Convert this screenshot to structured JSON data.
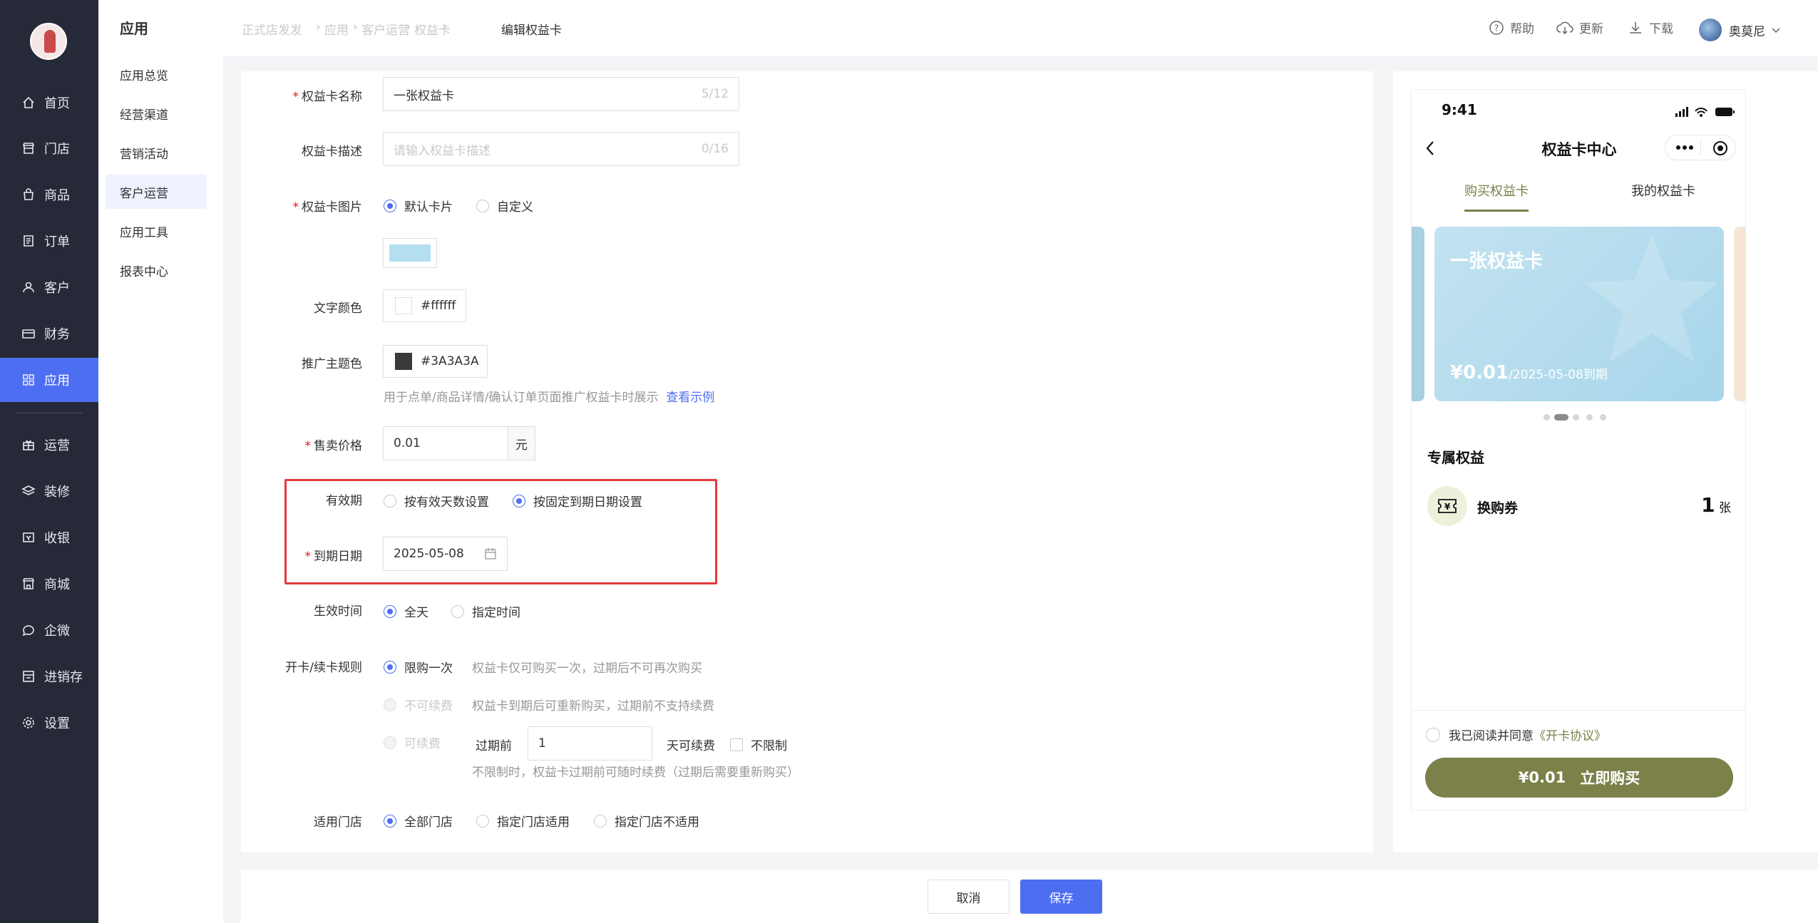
{
  "sidebar": {
    "items": [
      {
        "label": "首页",
        "icon": "home-icon"
      },
      {
        "label": "门店",
        "icon": "store-icon"
      },
      {
        "label": "商品",
        "icon": "bag-icon"
      },
      {
        "label": "订单",
        "icon": "order-icon"
      },
      {
        "label": "客户",
        "icon": "user-icon"
      },
      {
        "label": "财务",
        "icon": "card-icon"
      },
      {
        "label": "应用",
        "icon": "apps-icon",
        "active": true
      },
      {
        "label": "运营",
        "icon": "gift-icon"
      },
      {
        "label": "装修",
        "icon": "layers-icon"
      },
      {
        "label": "收银",
        "icon": "cashier-icon"
      },
      {
        "label": "商城",
        "icon": "mall-icon"
      },
      {
        "label": "企微",
        "icon": "chat-icon"
      },
      {
        "label": "进销存",
        "icon": "inventory-icon"
      },
      {
        "label": "设置",
        "icon": "settings-icon"
      }
    ]
  },
  "subnav": {
    "title": "应用",
    "items": [
      "应用总览",
      "经营渠道",
      "营销活动",
      "客户运营",
      "应用工具",
      "报表中心"
    ],
    "active_index": 3
  },
  "breadcrumb": [
    "正式店发发",
    "应用",
    "客户运营",
    "权益卡",
    "编辑权益卡"
  ],
  "topbar": {
    "help": "帮助",
    "update": "更新",
    "download": "下载",
    "user": "奥莫尼"
  },
  "form": {
    "name": {
      "label": "权益卡名称",
      "value": "一张权益卡",
      "count": "5/12"
    },
    "desc": {
      "label": "权益卡描述",
      "placeholder": "请输入权益卡描述",
      "count": "0/16"
    },
    "image": {
      "label": "权益卡图片",
      "options": [
        "默认卡片",
        "自定义"
      ],
      "selected": 0,
      "swatch_color": "#b3dff0"
    },
    "text_color": {
      "label": "文字颜色",
      "value": "#ffffff"
    },
    "theme_color": {
      "label": "推广主题色",
      "value": "#3A3A3A",
      "hint": "用于点单/商品详情/确认订单页面推广权益卡时展示",
      "hint_link": "查看示例"
    },
    "price": {
      "label": "售卖价格",
      "value": "0.01",
      "unit": "元"
    },
    "validity": {
      "label": "有效期",
      "options": [
        "按有效天数设置",
        "按固定到期日期设置"
      ],
      "selected": 1
    },
    "expire": {
      "label": "到期日期",
      "value": "2025-05-08"
    },
    "effective": {
      "label": "生效时间",
      "options": [
        "全天",
        "指定时间"
      ],
      "selected": 0
    },
    "rules": {
      "label": "开卡/续卡规则",
      "opt1": "限购一次",
      "opt1_hint": "权益卡仅可购买一次，过期后不可再次购买",
      "opt2": "不可续费",
      "opt2_hint": "权益卡到期后可重新购买，过期前不支持续费",
      "opt3": "可续费",
      "before": "过期前",
      "days_value": "1",
      "days_suffix": "天可续费",
      "unlimited": "不限制",
      "opt3_hint": "不限制时，权益卡过期前可随时续费（过期后需要重新购买）"
    },
    "stores": {
      "label": "适用门店",
      "options": [
        "全部门店",
        "指定门店适用",
        "指定门店不适用"
      ],
      "selected": 0
    }
  },
  "preview": {
    "time": "9:41",
    "title": "权益卡中心",
    "tabs": [
      "购买权益卡",
      "我的权益卡"
    ],
    "card_name": "一张权益卡",
    "card_price": "¥0.01",
    "card_expiry": "/2025-05-08到期",
    "section": "专属权益",
    "benefit_name": "换购券",
    "benefit_count": "1",
    "benefit_unit": "张",
    "agree_text": "我已阅读并同意",
    "agree_link": "《开卡协议》",
    "buy_price": "¥0.01",
    "buy_label": "立即购买",
    "accent": "#7b8149"
  },
  "footer": {
    "cancel": "取消",
    "save": "保存"
  }
}
